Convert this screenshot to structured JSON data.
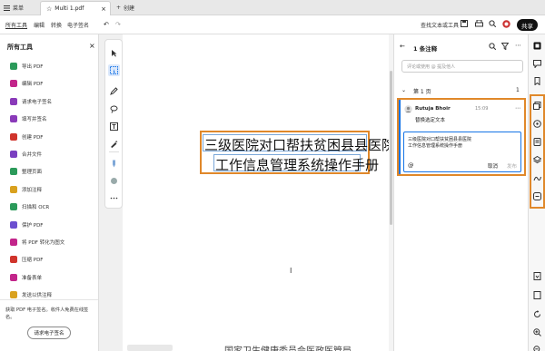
{
  "titlebar": {
    "menu_label": "菜单",
    "tab_title": "Multi 1.pdf",
    "new_tab_label": "创建"
  },
  "menubar": {
    "items": [
      "所有工具",
      "编辑",
      "转换",
      "电子签名"
    ],
    "search_label": "查找文本或工具",
    "share_label": "共享"
  },
  "left_panel": {
    "title": "所有工具",
    "tools": [
      {
        "label": "导出 PDF",
        "color": "#2b9a5a"
      },
      {
        "label": "编辑 PDF",
        "color": "#c2258a"
      },
      {
        "label": "请求电子签名",
        "color": "#8a3ab9"
      },
      {
        "label": "填写并签名",
        "color": "#8a3ab9"
      },
      {
        "label": "创建 PDF",
        "color": "#d0342c"
      },
      {
        "label": "合并文件",
        "color": "#7a3fc0"
      },
      {
        "label": "整理页面",
        "color": "#2b9a5a"
      },
      {
        "label": "添加注释",
        "color": "#d9a11e"
      },
      {
        "label": "扫描和 OCR",
        "color": "#2b9a5a"
      },
      {
        "label": "保护 PDF",
        "color": "#6b4fcf"
      },
      {
        "label": "将 PDF 转化为图文",
        "color": "#c2258a"
      },
      {
        "label": "压缩 PDF",
        "color": "#d0342c"
      },
      {
        "label": "准备表单",
        "color": "#c2258a"
      },
      {
        "label": "发送以供注释",
        "color": "#d9a11e"
      }
    ],
    "promo_text": "获取 PDF 电子签名。收件人免费在线签名。",
    "promo_button": "请求电子签名"
  },
  "document": {
    "line1": "三级医院对口帮扶贫困县县医院",
    "line2": "工作信息管理系统操作手册",
    "footer_text": "国家卫生健康委员会医政医管局"
  },
  "comments": {
    "header": "1 条注释",
    "search_placeholder": "评论或使用 @ 提及他人",
    "page_label": "第 1 页",
    "page_count": "1",
    "author": "Rutuja Bhoir",
    "time": "15:09",
    "action": "替换选定文本",
    "replacement_line1": "三级医院对口帮扶贫困县县医院",
    "replacement_line2": "工作信息管理系统操作手册",
    "cancel_label": "取消",
    "post_label": "发布"
  },
  "colors": {
    "highlight": "#e0882a",
    "accent_blue": "#1473e6"
  }
}
